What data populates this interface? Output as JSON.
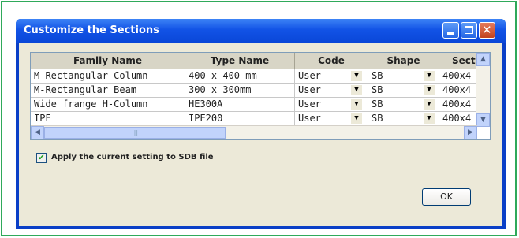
{
  "window": {
    "title": "Customize the Sections",
    "buttons": [
      "minimize",
      "maximize",
      "close"
    ]
  },
  "table": {
    "columns": [
      "Family Name",
      "Type Name",
      "Code",
      "Shape",
      "Sect"
    ],
    "rows": [
      {
        "family": "M-Rectangular Column",
        "type": "400 x 400 mm",
        "code": "User",
        "shape": "SB",
        "sect": "400x4"
      },
      {
        "family": "M-Rectangular Beam",
        "type": "300 x 300mm",
        "code": "User",
        "shape": "SB",
        "sect": "400x4"
      },
      {
        "family": "Wide frange H-Column",
        "type": "HE300A",
        "code": "User",
        "shape": "SB",
        "sect": "400x4"
      },
      {
        "family": "IPE",
        "type": "IPE200",
        "code": "User",
        "shape": "SB",
        "sect": "400x4"
      }
    ]
  },
  "options": {
    "apply_label": "Apply the current setting to SDB file",
    "apply_checked": true
  },
  "actions": {
    "ok_label": "OK"
  },
  "colors": {
    "frame": "#2fa95a",
    "titlebar": "#1253e6",
    "client": "#ece9d8"
  }
}
